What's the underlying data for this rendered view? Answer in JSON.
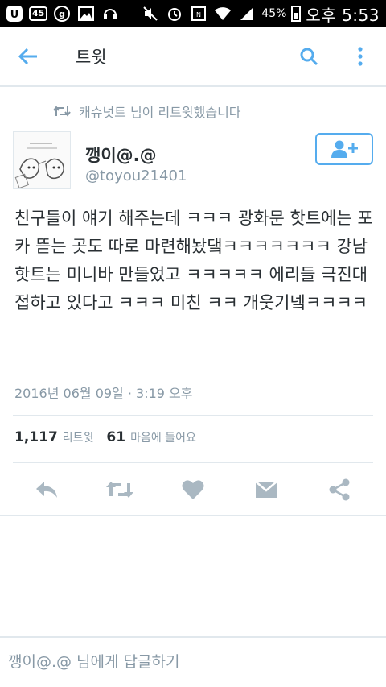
{
  "status_bar": {
    "time": "오후 5:53",
    "battery_percent": "45%",
    "badge_text": "45"
  },
  "app_bar": {
    "title": "트윗"
  },
  "retweet_context": {
    "text": "캐슈넛트 님이 리트윗했습니다"
  },
  "tweet": {
    "display_name": "깽이@.@",
    "handle": "@toyou21401",
    "text": "친구들이 얘기 해주는데 ㅋㅋㅋ 광화문 핫트에는 포카 뜯는 곳도 따로 마련해놨댘ㅋㅋㅋㅋㅋㅋㅋ 강남 핫트는 미니바 만들었고 ㅋㅋㅋㅋㅋ 에리들 극진대접하고 있다고 ㅋㅋㅋ 미친 ㅋㅋ 개웃기넼ㅋㅋㅋㅋ",
    "date": "2016년 06월 09일 · 3:19 오후",
    "retweet_count": "1,117",
    "retweet_label": "리트윗",
    "like_count": "61",
    "like_label": "마음에 들어요"
  },
  "reply": {
    "placeholder": "깽이@.@ 님에게 답글하기"
  },
  "colors": {
    "accent": "#55acee",
    "secondary_text": "#8899a6",
    "primary_text": "#292f33",
    "action_icon": "#aab8c2"
  }
}
